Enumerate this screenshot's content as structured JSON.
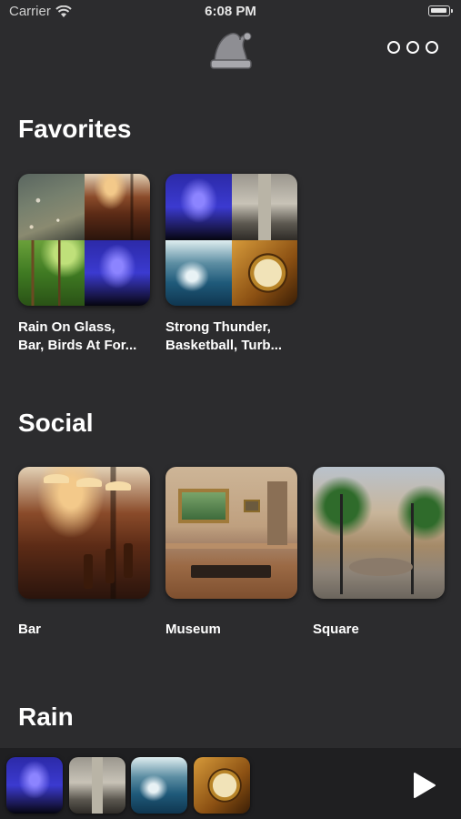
{
  "status_bar": {
    "carrier": "Carrier",
    "time": "6:08 PM"
  },
  "header": {
    "logo_icon": "sleep-cap-icon",
    "more_icon": "more-options-icon"
  },
  "sections": [
    {
      "title": "Favorites",
      "items": [
        {
          "line1": "Rain On Glass,",
          "line2": "Bar, Birds At For..."
        },
        {
          "line1": "Strong Thunder,",
          "line2": "Basketball, Turb..."
        }
      ]
    },
    {
      "title": "Social",
      "items": [
        {
          "label": "Bar"
        },
        {
          "label": "Museum"
        },
        {
          "label": "Square"
        }
      ]
    },
    {
      "title": "Rain"
    }
  ],
  "player": {
    "play_icon": "play-icon"
  },
  "colors": {
    "background": "#2c2c2e",
    "player_bar": "#1f1f21",
    "text": "#ffffff"
  }
}
